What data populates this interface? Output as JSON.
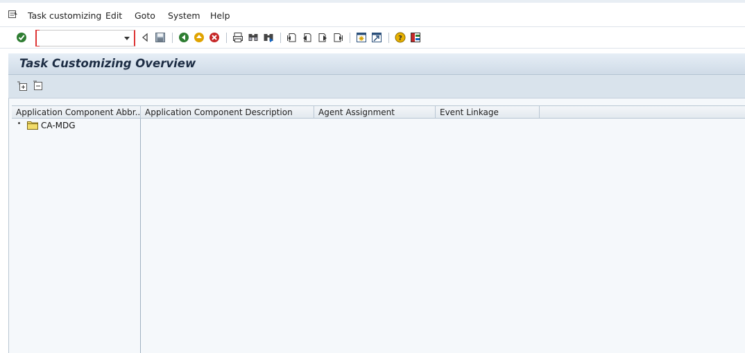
{
  "menubar": {
    "items": [
      {
        "label": "Task customizing"
      },
      {
        "label": "Edit"
      },
      {
        "label": "Goto"
      },
      {
        "label": "System"
      },
      {
        "label": "Help"
      }
    ]
  },
  "toolbar": {
    "command_field_value": "",
    "icons": [
      "enter-icon",
      "back-arrow-icon",
      "save-icon",
      "back-icon",
      "exit-icon",
      "cancel-icon",
      "print-icon",
      "find-icon",
      "find-next-icon",
      "first-page-icon",
      "previous-page-icon",
      "next-page-icon",
      "last-page-icon",
      "create-session-icon",
      "shortcut-icon",
      "help-icon",
      "layout-menu-icon"
    ]
  },
  "page": {
    "title": "Task Customizing Overview"
  },
  "tree": {
    "columns": [
      {
        "label": "Application Component Abbr..."
      },
      {
        "label": "Application Component Description"
      },
      {
        "label": "Agent Assignment"
      },
      {
        "label": "Event Linkage"
      }
    ],
    "nodes": [
      {
        "label": "CA-MDG"
      }
    ]
  },
  "colors": {
    "title_bar": "#cfdbe7",
    "app_toolbar": "#d9e3ec",
    "tree_background": "#f5f8fb",
    "title_text": "#1d2d44"
  }
}
